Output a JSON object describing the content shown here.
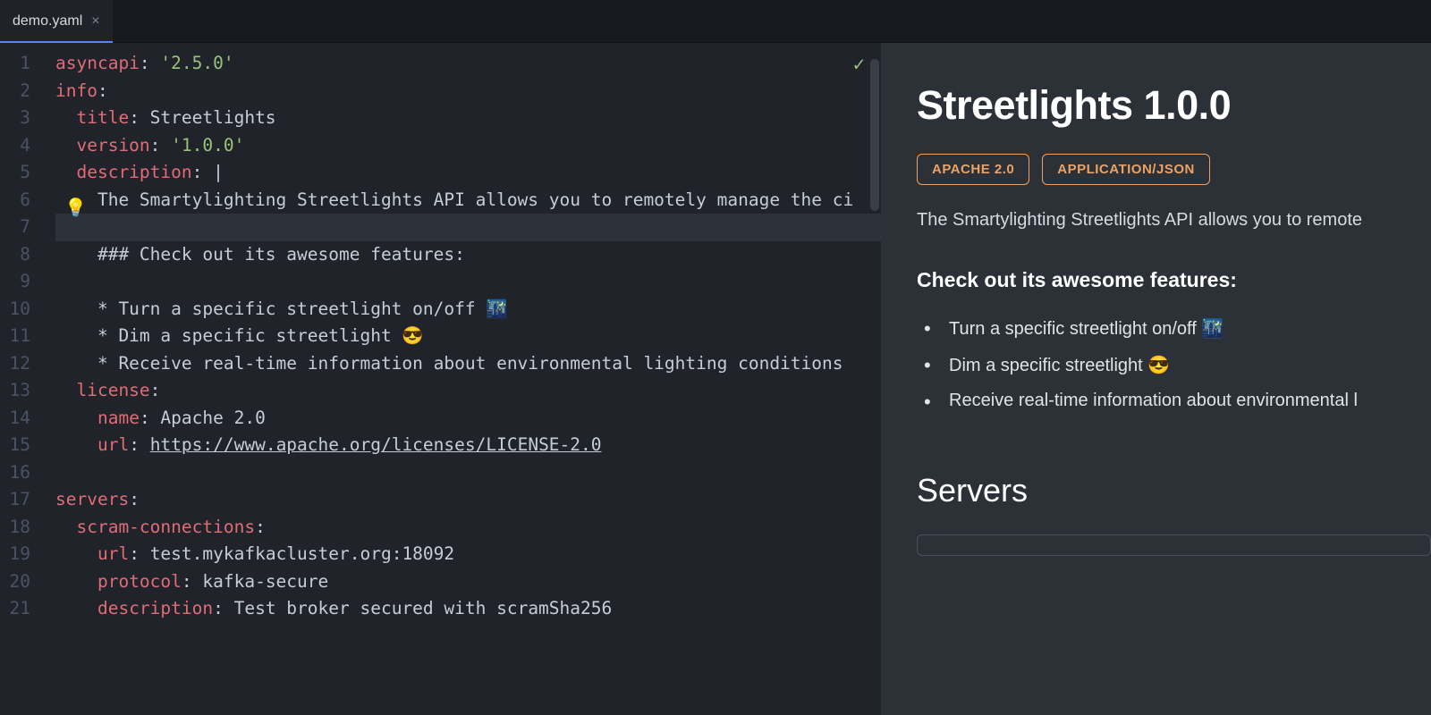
{
  "tab": {
    "name": "demo.yaml",
    "close_glyph": "×"
  },
  "editor": {
    "check_glyph": "✓",
    "bulb_glyph": "💡",
    "line_numbers": [
      "1",
      "2",
      "3",
      "4",
      "5",
      "6",
      "7",
      "8",
      "9",
      "10",
      "11",
      "12",
      "13",
      "14",
      "15",
      "16",
      "17",
      "18",
      "19",
      "20",
      "21"
    ],
    "lines": [
      {
        "tokens": [
          [
            "key",
            "asyncapi"
          ],
          [
            "txt",
            ": "
          ],
          [
            "str",
            "'2.5.0'"
          ]
        ]
      },
      {
        "tokens": [
          [
            "key",
            "info"
          ],
          [
            "txt",
            ":"
          ]
        ]
      },
      {
        "tokens": [
          [
            "txt",
            "  "
          ],
          [
            "key",
            "title"
          ],
          [
            "txt",
            ": "
          ],
          [
            "txt",
            "Streetlights"
          ]
        ]
      },
      {
        "tokens": [
          [
            "txt",
            "  "
          ],
          [
            "key",
            "version"
          ],
          [
            "txt",
            ": "
          ],
          [
            "str",
            "'1.0.0'"
          ]
        ]
      },
      {
        "tokens": [
          [
            "txt",
            "  "
          ],
          [
            "key",
            "description"
          ],
          [
            "txt",
            ": |"
          ]
        ]
      },
      {
        "tokens": [
          [
            "txt",
            "    The Smartylighting Streetlights API allows you to remotely manage the ci"
          ]
        ]
      },
      {
        "tokens": [
          [
            "txt",
            ""
          ]
        ],
        "current": true
      },
      {
        "tokens": [
          [
            "txt",
            "    ### Check out its awesome features:"
          ]
        ]
      },
      {
        "tokens": [
          [
            "txt",
            ""
          ]
        ]
      },
      {
        "tokens": [
          [
            "txt",
            "    * Turn a specific streetlight on/off 🌃"
          ]
        ]
      },
      {
        "tokens": [
          [
            "txt",
            "    * Dim a specific streetlight 😎"
          ]
        ]
      },
      {
        "tokens": [
          [
            "txt",
            "    * Receive real-time information about environmental lighting conditions "
          ]
        ]
      },
      {
        "tokens": [
          [
            "txt",
            "  "
          ],
          [
            "key",
            "license"
          ],
          [
            "txt",
            ":"
          ]
        ]
      },
      {
        "tokens": [
          [
            "txt",
            "    "
          ],
          [
            "key",
            "name"
          ],
          [
            "txt",
            ": "
          ],
          [
            "txt",
            "Apache 2.0"
          ]
        ]
      },
      {
        "tokens": [
          [
            "txt",
            "    "
          ],
          [
            "key",
            "url"
          ],
          [
            "txt",
            ": "
          ],
          [
            "url",
            "https://www.apache.org/licenses/LICENSE-2.0"
          ]
        ]
      },
      {
        "tokens": [
          [
            "txt",
            ""
          ]
        ]
      },
      {
        "tokens": [
          [
            "key",
            "servers"
          ],
          [
            "txt",
            ":"
          ]
        ]
      },
      {
        "tokens": [
          [
            "txt",
            "  "
          ],
          [
            "key",
            "scram-connections"
          ],
          [
            "txt",
            ":"
          ]
        ]
      },
      {
        "tokens": [
          [
            "txt",
            "    "
          ],
          [
            "key",
            "url"
          ],
          [
            "txt",
            ": "
          ],
          [
            "txt",
            "test.mykafkacluster.org:18092"
          ]
        ]
      },
      {
        "tokens": [
          [
            "txt",
            "    "
          ],
          [
            "key",
            "protocol"
          ],
          [
            "txt",
            ": "
          ],
          [
            "txt",
            "kafka-secure"
          ]
        ]
      },
      {
        "tokens": [
          [
            "txt",
            "    "
          ],
          [
            "key",
            "description"
          ],
          [
            "txt",
            ": "
          ],
          [
            "txt",
            "Test broker secured with scramSha256"
          ]
        ]
      }
    ]
  },
  "preview": {
    "title": "Streetlights 1.0.0",
    "badges": [
      "APACHE 2.0",
      "APPLICATION/JSON"
    ],
    "description": "The Smartylighting Streetlights API allows you to remote",
    "features_heading": "Check out its awesome features:",
    "features": [
      "Turn a specific streetlight on/off 🌃",
      "Dim a specific streetlight 😎",
      "Receive real-time information about environmental l"
    ],
    "servers_heading": "Servers"
  }
}
